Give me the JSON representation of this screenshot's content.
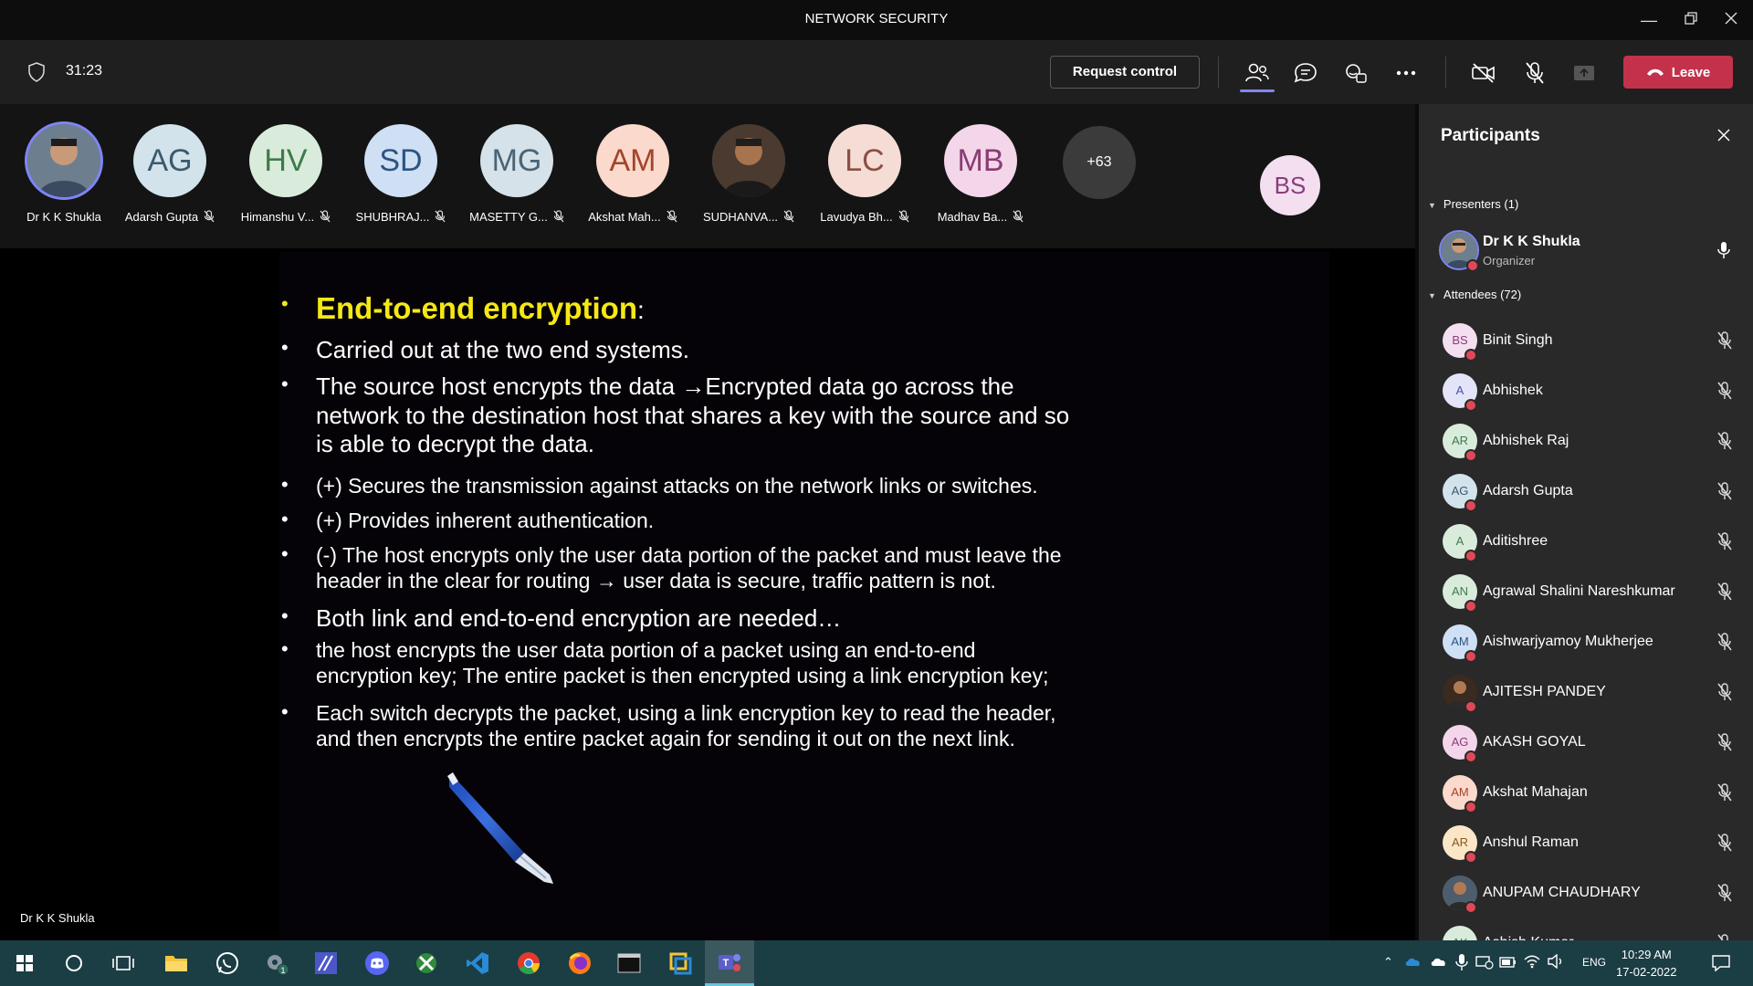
{
  "window": {
    "title": "NETWORK SECURITY"
  },
  "toolbar": {
    "timer": "31:23",
    "request_control": "Request control",
    "leave": "Leave",
    "leave_color": "#c4314b",
    "accent": "#7f85f5"
  },
  "strip": {
    "tiles": [
      {
        "initials": "",
        "name": "Dr K K Shukla",
        "bg": "#546e7a",
        "fg": "#ffffff",
        "photo": true
      },
      {
        "initials": "AG",
        "name": "Adarsh Gupta",
        "bg": "#d2e3ec",
        "fg": "#3a5a6e"
      },
      {
        "initials": "HV",
        "name": "Himanshu V...",
        "bg": "#d9ecdc",
        "fg": "#3e7a4a"
      },
      {
        "initials": "SD",
        "name": "SHUBHRAJ...",
        "bg": "#cfe0f4",
        "fg": "#2c5484"
      },
      {
        "initials": "MG",
        "name": "MASETTY G...",
        "bg": "#d6e2ea",
        "fg": "#4a6478"
      },
      {
        "initials": "AM",
        "name": "Akshat Mah...",
        "bg": "#fbd9cc",
        "fg": "#a3452a"
      },
      {
        "initials": "",
        "name": "SUDHANVA...",
        "bg": "#5d4037",
        "fg": "#ffffff",
        "photo": true
      },
      {
        "initials": "LC",
        "name": "Lavudya Bh...",
        "bg": "#f5ddd6",
        "fg": "#8a5045"
      },
      {
        "initials": "MB",
        "name": "Madhav Ba...",
        "bg": "#f3d6ea",
        "fg": "#8a3c74"
      }
    ],
    "more": "+63",
    "spotlight_initials": "BS"
  },
  "slide": {
    "heading": "End-to-end encryption",
    "heading_suffix": ":",
    "heading_color": "#f5e814",
    "bullets": [
      [
        "Carried out at the two end systems."
      ],
      [
        "The source host encrypts the data →Encrypted data go across the",
        "network to the destination host that shares a key with the source and so",
        "is able to decrypt the data."
      ],
      [
        "(+) Secures the transmission against attacks on the network links or switches."
      ],
      [
        "(+) Provides inherent authentication."
      ],
      [
        "(-) The host encrypts only the user data portion of the packet and must leave the",
        "header in the clear for routing → user data is secure, traffic pattern is not."
      ],
      [
        "Both link and end-to-end encryption are needed…"
      ],
      [
        "the host encrypts the user data portion of a packet using an end-to-end",
        "encryption key; The entire packet is then encrypted using a link encryption key;"
      ],
      [
        "Each switch decrypts the packet, using a link encryption key to read the header,",
        "and then encrypts the entire packet again for sending it out on the next link."
      ]
    ],
    "presenter_label": "Dr K K Shukla"
  },
  "panel": {
    "title": "Participants",
    "presenters_header": "Presenters (1)",
    "presenter": {
      "name": "Dr K K Shukla",
      "role": "Organizer"
    },
    "attendees_header": "Attendees (72)",
    "attendees": [
      {
        "initials": "BS",
        "name": "Binit Singh",
        "bg": "#f4dff0",
        "fg": "#8a3c7a"
      },
      {
        "initials": "A",
        "name": "Abhishek",
        "bg": "#e3e4f8",
        "fg": "#4a50a8"
      },
      {
        "initials": "AR",
        "name": "Abhishek Raj",
        "bg": "#d9ecdc",
        "fg": "#3e7a4a"
      },
      {
        "initials": "AG",
        "name": "Adarsh Gupta",
        "bg": "#d2e3ec",
        "fg": "#3a5a6e"
      },
      {
        "initials": "A",
        "name": "Aditishree",
        "bg": "#d9ecdc",
        "fg": "#3e7a4a"
      },
      {
        "initials": "AN",
        "name": "Agrawal Shalini Nareshkumar",
        "bg": "#d9ecdc",
        "fg": "#3e7a4a"
      },
      {
        "initials": "AM",
        "name": "Aishwarjyamoy Mukherjee",
        "bg": "#cfe0f4",
        "fg": "#2c5484"
      },
      {
        "initials": "",
        "name": "AJITESH PANDEY",
        "bg": "#3a2a1f",
        "fg": "#ffffff"
      },
      {
        "initials": "AG",
        "name": "AKASH GOYAL",
        "bg": "#f3d6ea",
        "fg": "#8a3c74"
      },
      {
        "initials": "AM",
        "name": "Akshat Mahajan",
        "bg": "#fbd9cc",
        "fg": "#a3452a"
      },
      {
        "initials": "AR",
        "name": "Anshul Raman",
        "bg": "#fbe6c8",
        "fg": "#8a5a1a"
      },
      {
        "initials": "",
        "name": "ANUPAM CHAUDHARY",
        "bg": "#4e5d6c",
        "fg": "#ffffff"
      },
      {
        "initials": "AK",
        "name": "Ashish Kumar",
        "bg": "#d9ecdc",
        "fg": "#3e7a4a"
      }
    ]
  },
  "taskbar": {
    "lang": "ENG",
    "time": "10:29 AM",
    "date": "17-02-2022",
    "badge": "1"
  }
}
